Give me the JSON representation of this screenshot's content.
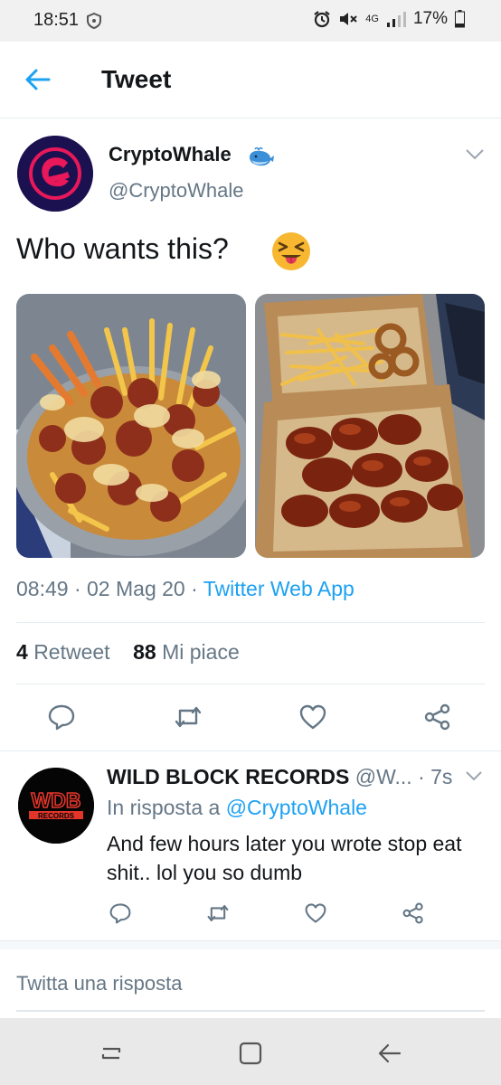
{
  "status_bar": {
    "time": "18:51",
    "battery": "17%",
    "network": "4G"
  },
  "header": {
    "title": "Tweet",
    "back_icon": "back-arrow-icon"
  },
  "tweet": {
    "author_name": "CryptoWhale",
    "author_handle": "@CryptoWhale",
    "text": "Who wants this?",
    "emoji": "squinting-face-with-tongue",
    "time": "08:49",
    "date": "02 Mag 20",
    "source": "Twitter Web App",
    "retweets": "4",
    "retweets_label": "Retweet",
    "likes": "88",
    "likes_label": "Mi piace"
  },
  "reply": {
    "author_name": "WILD BLOCK RECORDS",
    "author_handle": "@W...",
    "age": "· 7s",
    "reply_prefix": "In risposta a",
    "reply_mention": "@CryptoWhale",
    "text": "And few hours later you wrote stop eat shit.. lol you so dumb",
    "avatar_text": "WDB",
    "avatar_subtext": "RECORDS"
  },
  "compose": {
    "placeholder": "Twitta una risposta"
  },
  "colors": {
    "accent": "#1da1f2",
    "secondary_text": "#657786",
    "primary_text": "#14171a"
  }
}
